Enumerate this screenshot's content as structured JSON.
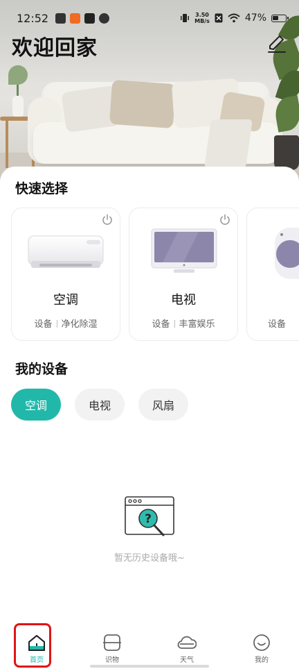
{
  "status_bar": {
    "time": "12:52",
    "net_speed_value": "3.50",
    "net_speed_unit": "MB/s",
    "battery": "47%",
    "battery_level": 0.47
  },
  "header": {
    "title": "欢迎回家"
  },
  "quick_select": {
    "title": "快速选择",
    "cards": [
      {
        "name": "空调",
        "category": "设备",
        "description": "净化除湿"
      },
      {
        "name": "电视",
        "category": "设备",
        "description": "丰富娱乐"
      },
      {
        "name": "",
        "category": "设备",
        "description": ""
      }
    ]
  },
  "my_devices": {
    "title": "我的设备",
    "chips": [
      {
        "label": "空调",
        "active": true
      },
      {
        "label": "电视",
        "active": false
      },
      {
        "label": "风扇",
        "active": false
      }
    ],
    "empty_text": "暂无历史设备哦~"
  },
  "tabbar": {
    "items": [
      {
        "label": "首页",
        "icon": "home-icon",
        "active": true
      },
      {
        "label": "识物",
        "icon": "scan-icon",
        "active": false
      },
      {
        "label": "天气",
        "icon": "cloud-icon",
        "active": false
      },
      {
        "label": "我的",
        "icon": "smile-icon",
        "active": false
      }
    ]
  },
  "colors": {
    "accent": "#21b8aa",
    "highlight_box": "#e01414"
  }
}
